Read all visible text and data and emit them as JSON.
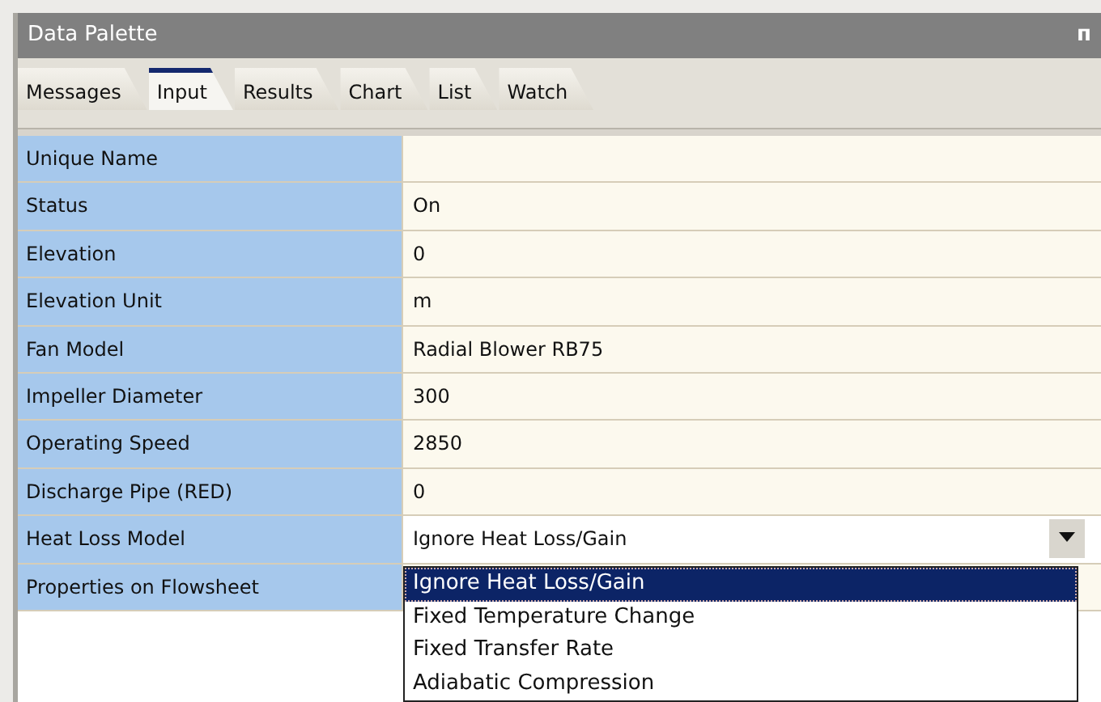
{
  "window": {
    "title": "Data Palette",
    "pin": "ᴨ"
  },
  "tabs": [
    {
      "label": "Messages",
      "selected": false
    },
    {
      "label": "Input",
      "selected": true
    },
    {
      "label": "Results",
      "selected": false
    },
    {
      "label": "Chart",
      "selected": false
    },
    {
      "label": "List",
      "selected": false
    },
    {
      "label": "Watch",
      "selected": false
    }
  ],
  "rows": [
    {
      "label": "Unique Name",
      "value": "",
      "kind": "text"
    },
    {
      "label": "Status",
      "value": "On",
      "kind": "text"
    },
    {
      "label": "Elevation",
      "value": "0",
      "kind": "text"
    },
    {
      "label": "Elevation Unit",
      "value": "m",
      "kind": "text"
    },
    {
      "label": "Fan Model",
      "value": "Radial Blower RB75",
      "kind": "text"
    },
    {
      "label": "Impeller Diameter",
      "value": "300",
      "kind": "text"
    },
    {
      "label": "Operating Speed",
      "value": "2850",
      "kind": "text"
    },
    {
      "label": "Discharge Pipe (RED)",
      "value": "0",
      "kind": "text"
    },
    {
      "label": "Heat Loss Model",
      "value": "Ignore Heat Loss/Gain",
      "kind": "combo"
    },
    {
      "label": "Properties on Flowsheet",
      "value": "",
      "kind": "text"
    }
  ],
  "dropdown_list": [
    {
      "label": "Ignore Heat Loss/Gain",
      "selected": true
    },
    {
      "label": "Fixed Temperature Change",
      "selected": false
    },
    {
      "label": "Fixed Transfer Rate",
      "selected": false
    },
    {
      "label": "Adiabatic Compression",
      "selected": false
    }
  ]
}
